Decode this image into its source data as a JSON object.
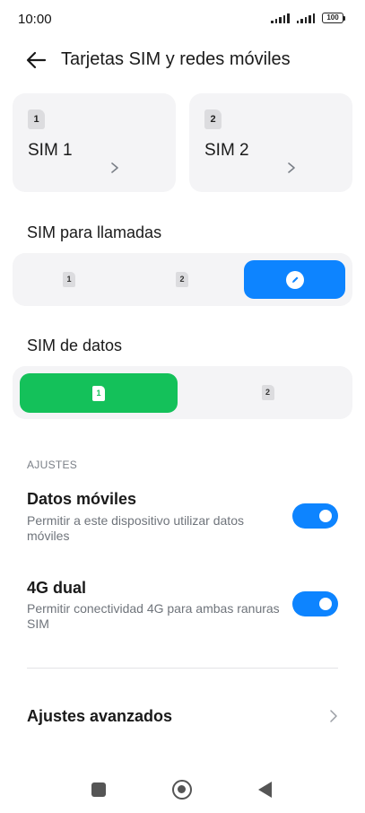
{
  "status_bar": {
    "time": "10:00",
    "battery": "100"
  },
  "header": {
    "title": "Tarjetas SIM y redes móviles"
  },
  "sim_cards": [
    {
      "badge": "1",
      "name": "SIM 1"
    },
    {
      "badge": "2",
      "name": "SIM 2"
    }
  ],
  "calls": {
    "label": "SIM para llamadas",
    "options": [
      "1",
      "2"
    ],
    "selected": "ask-every-time",
    "selected_color": "#0d84ff"
  },
  "data_sim": {
    "label": "SIM de datos",
    "options": [
      "1",
      "2"
    ],
    "selected": "1",
    "selected_color": "#14c15a"
  },
  "settings": {
    "group_label": "AJUSTES",
    "mobile_data": {
      "title": "Datos móviles",
      "description": "Permitir a este dispositivo utilizar datos móviles",
      "enabled": true
    },
    "dual_4g": {
      "title": "4G dual",
      "description": "Permitir conectividad 4G para ambas ranuras SIM",
      "enabled": true
    },
    "advanced": {
      "label": "Ajustes avanzados"
    }
  },
  "colors": {
    "accent_blue": "#0d84ff",
    "accent_green": "#14c15a",
    "card_bg": "#f4f4f6"
  },
  "icons": {
    "back": "arrow-left-icon",
    "chevron": "chevron-right-icon",
    "ask": "pencil-icon",
    "nav_recents": "square-icon",
    "nav_home": "circle-icon",
    "nav_back": "triangle-back-icon"
  }
}
